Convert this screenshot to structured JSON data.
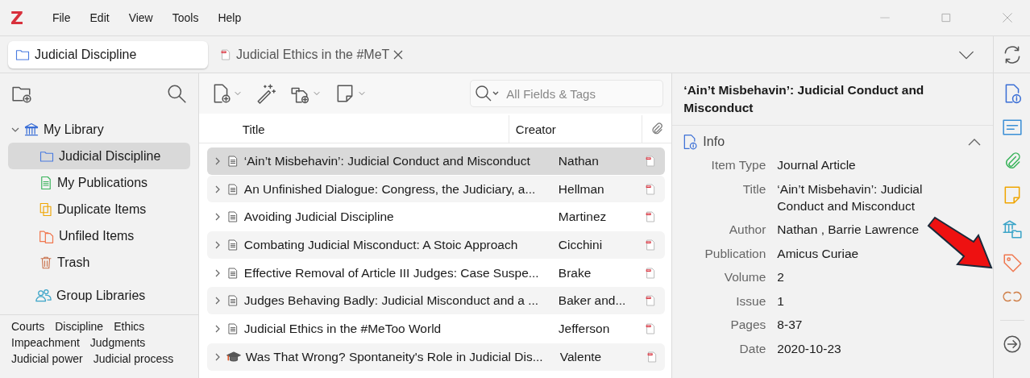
{
  "app": {
    "logo": "Z"
  },
  "menu": [
    "File",
    "Edit",
    "View",
    "Tools",
    "Help"
  ],
  "tabs": [
    {
      "label": "Judicial Discipline",
      "kind": "library",
      "selected": true
    },
    {
      "label": "Judicial Ethics in the #MeT",
      "kind": "pdf",
      "selected": false
    }
  ],
  "collections": [
    {
      "label": "My Library",
      "kind": "library",
      "expanded": true,
      "selected": false,
      "children": [
        {
          "label": "Judicial Discipline",
          "kind": "folder",
          "selected": true
        },
        {
          "label": "My Publications",
          "kind": "publications",
          "selected": false
        },
        {
          "label": "Duplicate Items",
          "kind": "duplicates",
          "selected": false
        },
        {
          "label": "Unfiled Items",
          "kind": "unfiled",
          "selected": false
        },
        {
          "label": "Trash",
          "kind": "trash",
          "selected": false
        }
      ]
    },
    {
      "label": "Group Libraries",
      "kind": "groups",
      "selected": false
    }
  ],
  "tags": [
    "Courts",
    "Discipline",
    "Ethics",
    "Impeachment",
    "Judgments",
    "Judicial power",
    "Judicial process"
  ],
  "search": {
    "placeholder": "All Fields & Tags"
  },
  "table": {
    "columns": [
      "Title",
      "Creator"
    ],
    "rows": [
      {
        "kind": "article",
        "title": "‘Ain’t Misbehavin’: Judicial Conduct and Misconduct",
        "creator": "Nathan",
        "selected": true,
        "expanded": false
      },
      {
        "kind": "article",
        "title": "An Unfinished Dialogue: Congress, the Judiciary, a...",
        "creator": "Hellman",
        "selected": false,
        "expanded": false
      },
      {
        "kind": "article",
        "title": "Avoiding Judicial Discipline",
        "creator": "Martinez",
        "selected": false,
        "expanded": false
      },
      {
        "kind": "article",
        "title": "Combating Judicial Misconduct: A Stoic Approach",
        "creator": "Cicchini",
        "selected": false,
        "expanded": false
      },
      {
        "kind": "article",
        "title": "Effective Removal of Article III Judges: Case Suspe...",
        "creator": "Brake",
        "selected": false,
        "expanded": false
      },
      {
        "kind": "article",
        "title": "Judges Behaving Badly: Judicial Misconduct and a ...",
        "creator": "Baker and...",
        "selected": false,
        "expanded": false
      },
      {
        "kind": "article",
        "title": "Judicial Ethics in the #MeToo World",
        "creator": "Jefferson",
        "selected": false,
        "expanded": false
      },
      {
        "kind": "thesis",
        "title": "Was That Wrong? Spontaneity's Role in Judicial Dis...",
        "creator": "Valente",
        "selected": false,
        "expanded": false
      }
    ]
  },
  "item_pane": {
    "header": "‘Ain’t Misbehavin’: Judicial Conduct and Misconduct",
    "section": {
      "title": "Info",
      "expanded": true
    },
    "fields": [
      {
        "label": "Item Type",
        "value": "Journal Article"
      },
      {
        "label": "Title",
        "value": "‘Ain’t Misbehavin’: Judicial Conduct and Misconduct"
      },
      {
        "label": "Author",
        "value": "Nathan , Barrie Lawrence"
      },
      {
        "label": "Publication",
        "value": "Amicus Curiae"
      },
      {
        "label": "Volume",
        "value": "2"
      },
      {
        "label": "Issue",
        "value": "1"
      },
      {
        "label": "Pages",
        "value": "8-37"
      },
      {
        "label": "Date",
        "value": "2020-10-23"
      }
    ]
  },
  "annotations": [
    {
      "kind": "arrow"
    }
  ]
}
